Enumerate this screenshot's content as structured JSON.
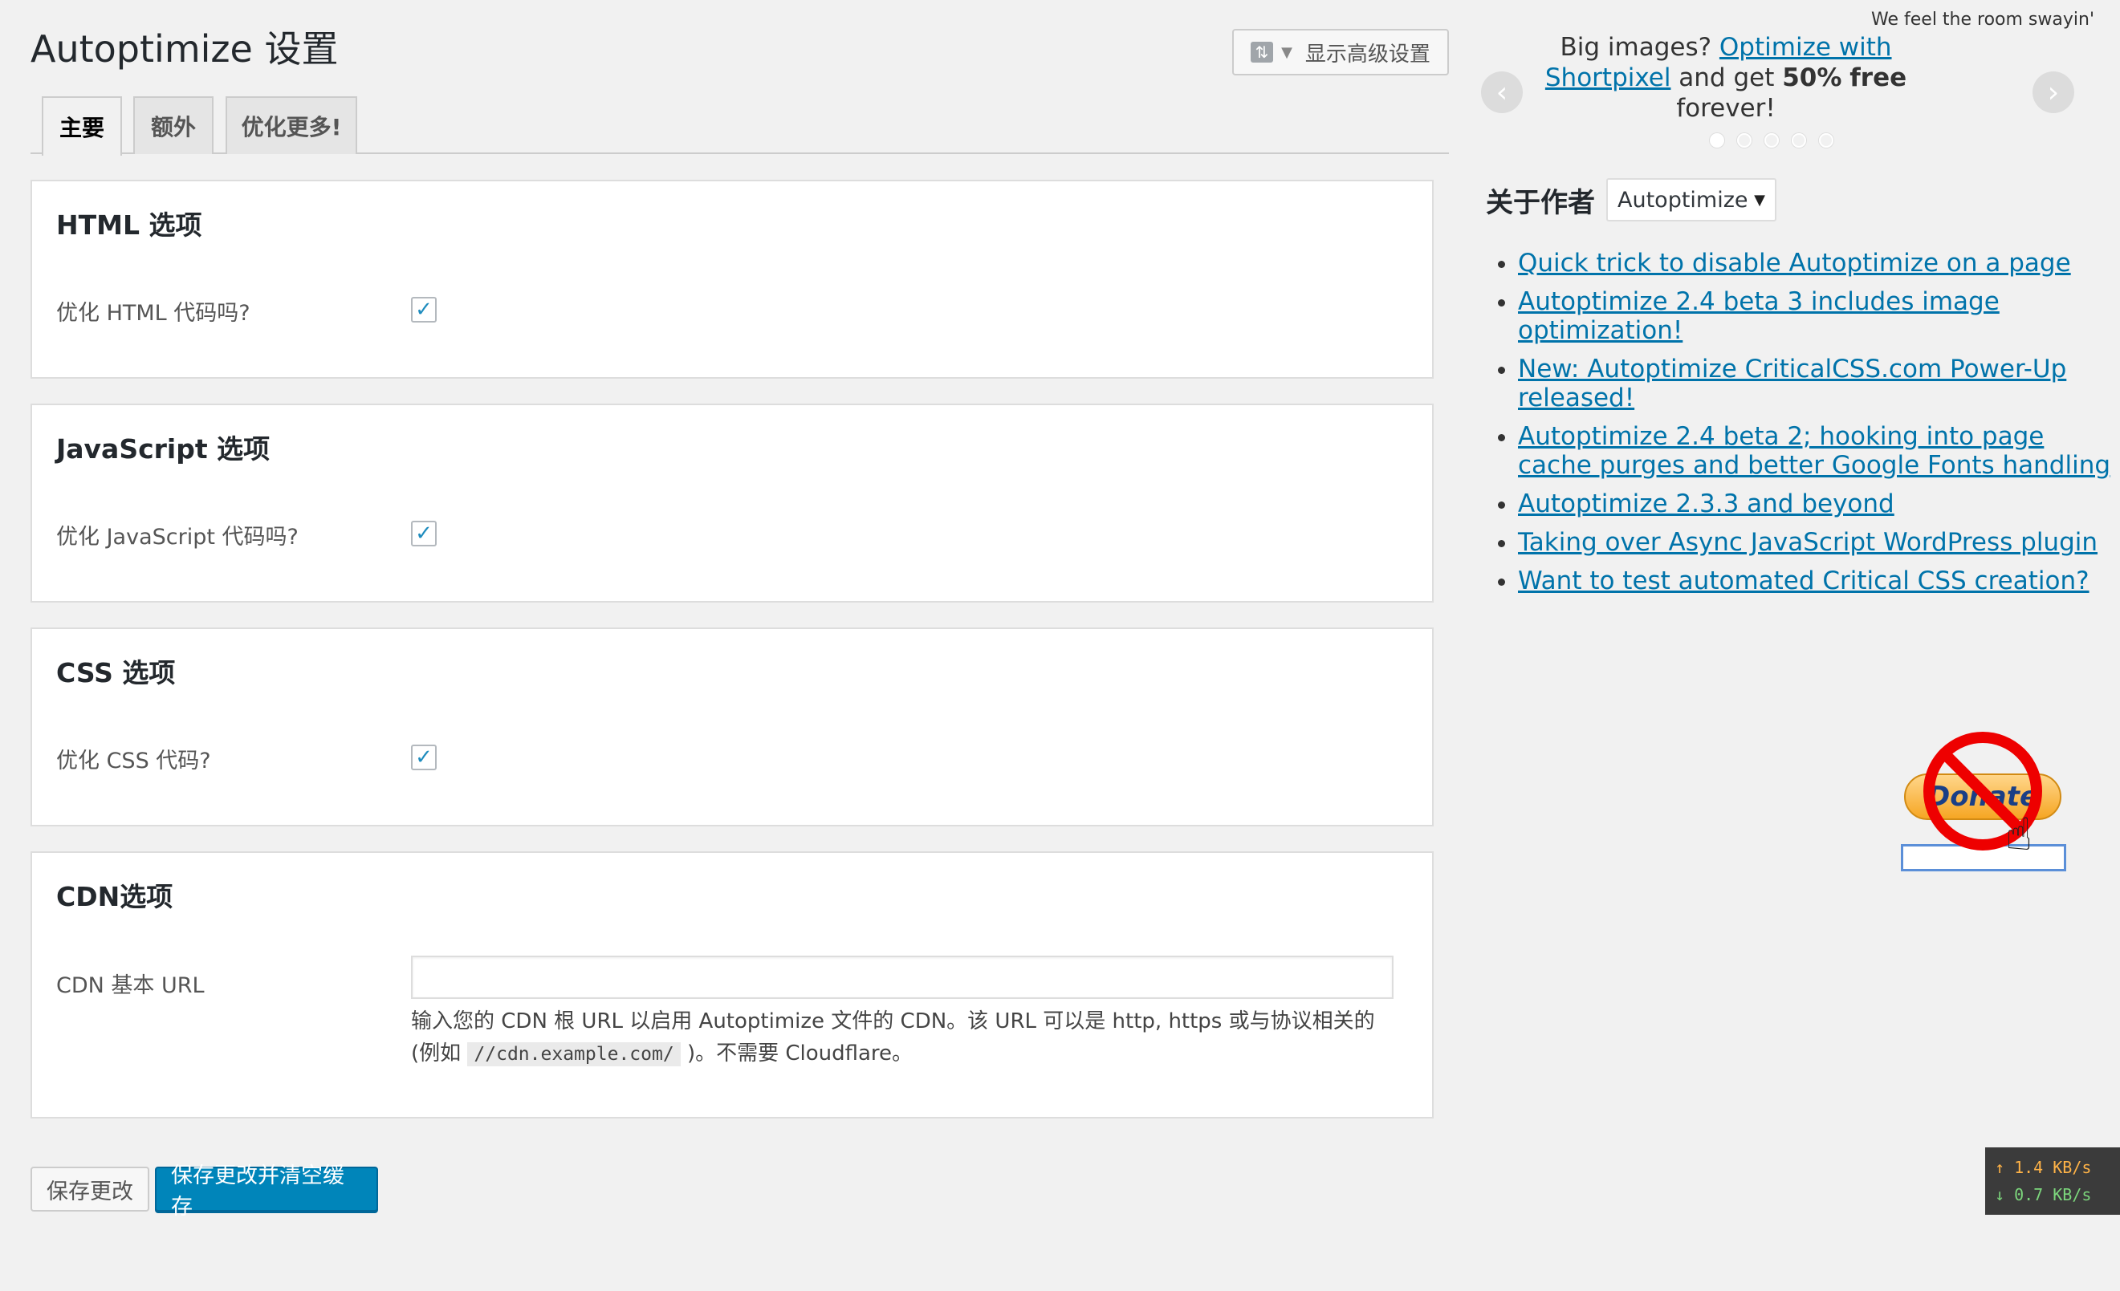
{
  "page": {
    "title": "Autoptimize 设置",
    "advanced_toggle": "显示高级设置"
  },
  "tabs": [
    {
      "label": "主要",
      "active": true
    },
    {
      "label": "额外",
      "active": false
    },
    {
      "label": "优化更多!",
      "active": false
    }
  ],
  "sections": {
    "html": {
      "title": "HTML 选项",
      "label": "优化 HTML 代码吗?",
      "checked": true
    },
    "js": {
      "title": "JavaScript 选项",
      "label": "优化 JavaScript 代码吗?",
      "checked": true
    },
    "css": {
      "title": "CSS 选项",
      "label": "优化 CSS 代码?",
      "checked": true
    },
    "cdn": {
      "title": "CDN选项",
      "label": "CDN 基本 URL",
      "value": "",
      "desc_before": "输入您的 CDN 根 URL 以启用 Autoptimize 文件的 CDN。该 URL 可以是 http, https 或与协议相关的 (例如",
      "desc_code": "//cdn.example.com/",
      "desc_after": ")。不需要 Cloudflare。"
    }
  },
  "buttons": {
    "save": "保存更改",
    "save_clear": "保存更改并清空缓存"
  },
  "sidebar": {
    "tagline": "We feel the room swayin'",
    "promo": {
      "prefix": "Big images? ",
      "link": "Optimize with Shortpixel",
      "mid": " and get ",
      "bold1": "50%",
      "bold2": "free",
      "suffix": " forever!"
    },
    "arrow_prev": "‹",
    "arrow_next": "›",
    "dots": 5,
    "news_title": "关于作者",
    "feed_select": "Autoptimize",
    "news": [
      "Quick trick to disable Autoptimize on a page",
      "Autoptimize 2.4 beta 3 includes image optimization!",
      "New: Autoptimize CriticalCSS.com Power-Up released!",
      "Autoptimize 2.4 beta 2; hooking into page cache purges and better Google Fonts handling",
      "Autoptimize 2.3.3 and beyond",
      "Taking over Async JavaScript WordPress plugin",
      "Want to test automated Critical CSS creation?"
    ],
    "donate_text": "Donate"
  },
  "netspeed": {
    "up": "1.4 KB/s",
    "down": "0.7 KB/s"
  },
  "colors": {
    "primary": "#0085ba",
    "link": "#0073aa",
    "check": "#1e8cbe",
    "no_sign": "#ee0000"
  }
}
